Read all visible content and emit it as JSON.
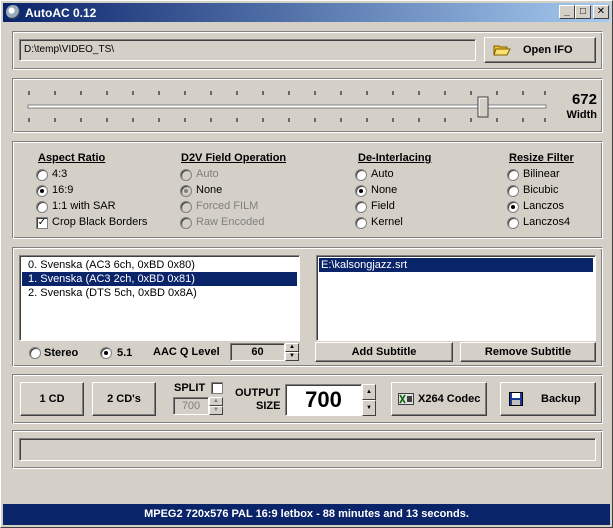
{
  "window": {
    "title": "AutoAC 0.12"
  },
  "titlebar_buttons": {
    "minimize": "_",
    "maximize": "□",
    "close": "✕"
  },
  "source": {
    "path": "D:\\temp\\VIDEO_TS\\",
    "open_label": "Open IFO"
  },
  "width_slider": {
    "value": "672",
    "label": "Width"
  },
  "aspect_ratio": {
    "heading": "Aspect Ratio",
    "options": [
      "4:3",
      "16:9",
      "1:1 with SAR"
    ],
    "selected": "16:9",
    "crop_label": "Crop Black Borders",
    "crop_checked": true
  },
  "d2v": {
    "heading": "D2V Field Operation",
    "options": [
      "Auto",
      "None",
      "Forced FILM",
      "Raw Encoded"
    ],
    "selected": "None"
  },
  "deinterlacing": {
    "heading": "De-Interlacing",
    "options": [
      "Auto",
      "None",
      "Field",
      "Kernel"
    ],
    "selected": "None"
  },
  "resize_filter": {
    "heading": "Resize Filter",
    "options": [
      "Bilinear",
      "Bicubic",
      "Lanczos",
      "Lanczos4"
    ],
    "selected": "Lanczos"
  },
  "audio_tracks": {
    "items": [
      "0. Svenska (AC3 6ch, 0xBD 0x80)",
      "1. Svenska (AC3 2ch, 0xBD 0x81)",
      "2. Svenska (DTS 5ch, 0xBD 0x8A)"
    ],
    "selected_index": 1
  },
  "audio_mode": {
    "stereo": "Stereo",
    "surround": "5.1",
    "selected": "5.1"
  },
  "aac": {
    "label": "AAC Q Level",
    "value": "60"
  },
  "subtitles": {
    "items": [
      "E:\\kalsongjazz.srt"
    ],
    "add_label": "Add Subtitle",
    "remove_label": "Remove Subtitle"
  },
  "output": {
    "one_cd": "1 CD",
    "two_cds": "2 CD's",
    "split_label": "SPLIT",
    "split_value": "700",
    "size_label_1": "OUTPUT",
    "size_label_2": "SIZE",
    "size_value": "700",
    "codec_label": "X264 Codec",
    "backup_label": "Backup"
  },
  "status": {
    "text": "MPEG2 720x576 PAL 16:9 letbox  - 88 minutes and 13 seconds."
  },
  "colors": {
    "face": "#d4d0c8",
    "selection": "#0a246a",
    "titlebar": "#0a246a"
  }
}
